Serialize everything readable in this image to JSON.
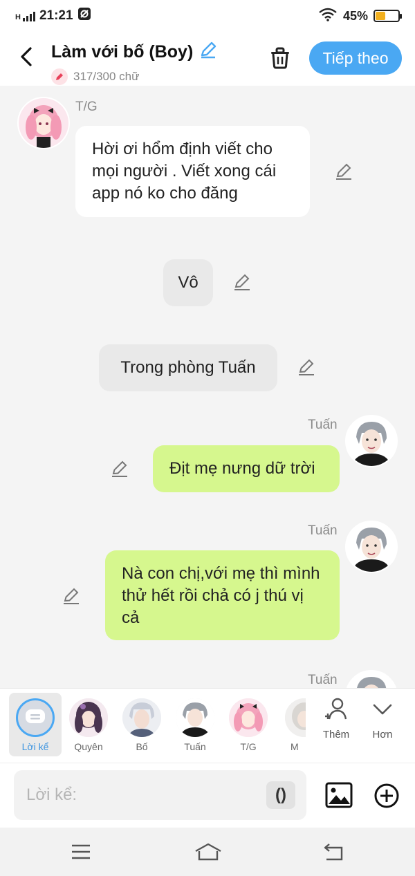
{
  "status_bar": {
    "net": "H",
    "time": "21:21",
    "battery": "45%",
    "battery_level": 0.45
  },
  "header": {
    "title": "Làm với bố (Boy)",
    "word_count": "317/300 chữ",
    "next_label": "Tiếp theo"
  },
  "messages": [
    {
      "speaker": "T/G",
      "text": "Hời ơi hổm định viết cho mọi người . Viết xong cái app nó ko cho đăng",
      "style": "white"
    },
    {
      "text": "Vô",
      "style": "narration"
    },
    {
      "text": "Trong phòng Tuấn",
      "style": "narration"
    },
    {
      "speaker": "Tuấn",
      "text": "Địt mẹ nưng dữ trời",
      "style": "green"
    },
    {
      "speaker": "Tuấn",
      "text": "Nà con chị,với mẹ thì mình thử hết rồi chả có j thú vị cả",
      "style": "green"
    },
    {
      "speaker": "Tuấn"
    }
  ],
  "characters": [
    {
      "label": "Lời kể"
    },
    {
      "label": "Quyên"
    },
    {
      "label": "Bố"
    },
    {
      "label": "Tuấn"
    },
    {
      "label": "T/G"
    },
    {
      "label": "M"
    }
  ],
  "actions": {
    "add_label": "Thêm",
    "more_label": "Hơn"
  },
  "input": {
    "placeholder": "Lời kể:",
    "paren": "()"
  },
  "colors": {
    "accent": "#4aa8f3",
    "green_bubble": "#d6f78e",
    "background": "#f4f4f4"
  }
}
